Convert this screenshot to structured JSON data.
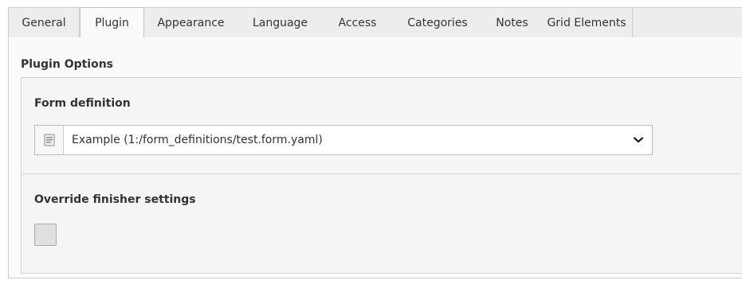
{
  "tabs": [
    {
      "label": "General"
    },
    {
      "label": "Plugin"
    },
    {
      "label": "Appearance"
    },
    {
      "label": "Language"
    },
    {
      "label": "Access"
    },
    {
      "label": "Categories"
    },
    {
      "label": "Notes"
    },
    {
      "label": "Grid Elements"
    }
  ],
  "active_tab": "Plugin",
  "section": {
    "title": "Plugin Options"
  },
  "form_definition": {
    "label": "Form definition",
    "selected_value": "Example (1:/form_definitions/test.form.yaml)",
    "icon": "form-document-icon"
  },
  "override_finisher": {
    "label": "Override finisher settings",
    "checked": false
  },
  "colors": {
    "tabbar_bg": "#ededed",
    "panel_bg": "#fafafa",
    "fieldset_bg": "#f5f5f5",
    "checkbox_bg": "#e0e0e0"
  }
}
